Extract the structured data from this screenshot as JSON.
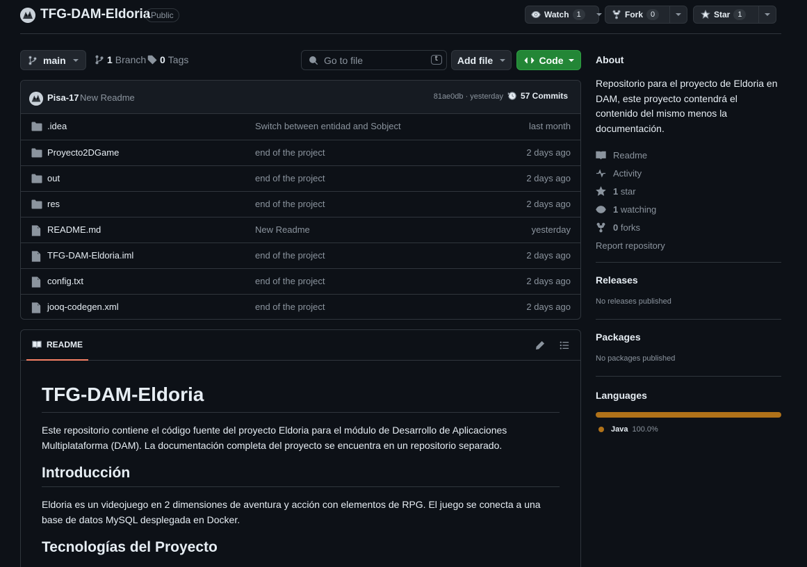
{
  "repo": {
    "name": "TFG-DAM-Eldoria",
    "visibility": "Public",
    "watch_label": "Watch",
    "watch_count": "1",
    "fork_label": "Fork",
    "fork_count": "0",
    "star_label": "Star",
    "star_count": "1"
  },
  "toolbar": {
    "branch": "main",
    "branches_count": "1",
    "branches_label": "Branch",
    "tags_count": "0",
    "tags_label": "Tags",
    "goto_placeholder": "Go to file",
    "goto_shortcut": "t",
    "add_file_label": "Add file",
    "code_label": "Code"
  },
  "commit": {
    "author": "Pisa-17",
    "message": "New Readme",
    "meta": "81ae0db · yesterday",
    "commits_label": "57 Commits"
  },
  "files": [
    {
      "name": ".idea",
      "type": "folder",
      "commit": "Switch between entidad and Sobject",
      "date": "last month"
    },
    {
      "name": "Proyecto2DGame",
      "type": "folder",
      "commit": "end of the project",
      "date": "2 days ago"
    },
    {
      "name": "out",
      "type": "folder",
      "commit": "end of the project",
      "date": "2 days ago"
    },
    {
      "name": "res",
      "type": "folder",
      "commit": "end of the project",
      "date": "2 days ago"
    },
    {
      "name": "README.md",
      "type": "file",
      "commit": "New Readme",
      "date": "yesterday"
    },
    {
      "name": "TFG-DAM-Eldoria.iml",
      "type": "file",
      "commit": "end of the project",
      "date": "2 days ago"
    },
    {
      "name": "config.txt",
      "type": "file",
      "commit": "end of the project",
      "date": "2 days ago"
    },
    {
      "name": "jooq-codegen.xml",
      "type": "file",
      "commit": "end of the project",
      "date": "2 days ago"
    }
  ],
  "readme": {
    "tab_label": "README",
    "title": "TFG-DAM-Eldoria",
    "intro": "Este repositorio contiene el código fuente del proyecto Eldoria para el módulo de Desarrollo de Aplicaciones Multiplataforma (DAM). La documentación completa del proyecto se encuentra en un repositorio separado.",
    "h2_intro": "Introducción",
    "intro_text": "Eldoria es un videojuego en 2 dimensiones de aventura y acción con elementos de RPG. El juego se conecta a una base de datos MySQL desplegada en Docker.",
    "h2_tech": "Tecnologías del Proyecto"
  },
  "about": {
    "heading": "About",
    "description": "Repositorio para el proyecto de Eldoria en DAM, este proyecto contendrá el contenido del mismo menos la documentación.",
    "readme_label": "Readme",
    "activity_label": "Activity",
    "stars_count": "1",
    "stars_label": "star",
    "watching_count": "1",
    "watching_label": "watching",
    "forks_count": "0",
    "forks_label": "forks",
    "report_label": "Report repository"
  },
  "releases": {
    "heading": "Releases",
    "text": "No releases published"
  },
  "packages": {
    "heading": "Packages",
    "text": "No packages published"
  },
  "languages": {
    "heading": "Languages",
    "items": [
      {
        "name": "Java",
        "percent": "100.0%",
        "color": "#b07219"
      }
    ]
  },
  "colors": {
    "background": "#0d1117",
    "border": "#30363d",
    "accent_green": "#238636",
    "readme_tab_underline": "#f78166",
    "java": "#b07219"
  }
}
